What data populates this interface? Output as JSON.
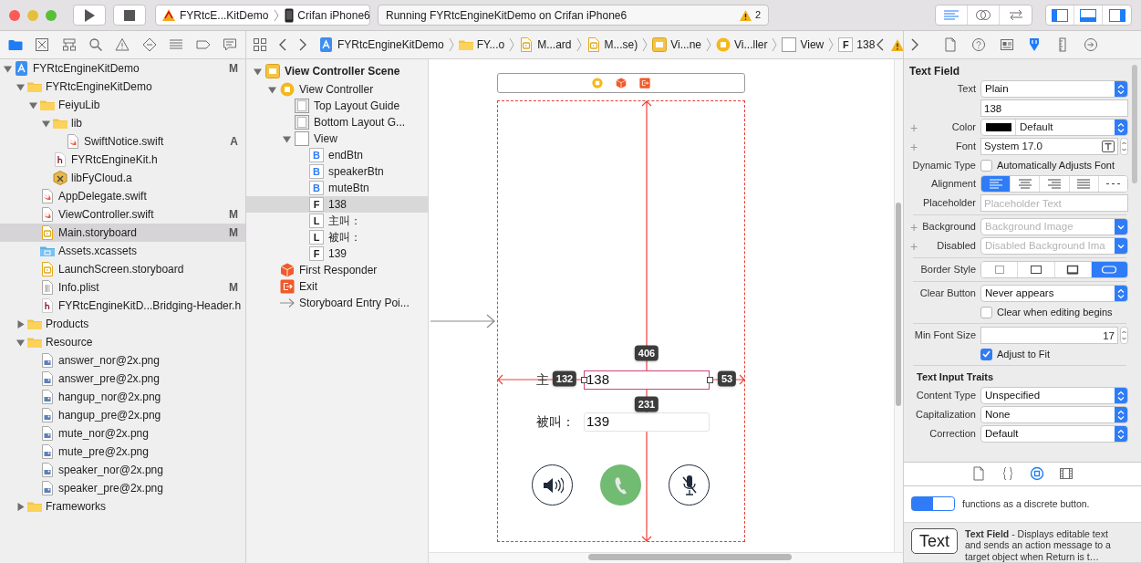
{
  "toolbar": {
    "scheme": {
      "target": "FYRtcE...KitDemo",
      "device": "Crifan iPhone6"
    },
    "activity": {
      "text": "Running FYRtcEngineKitDemo on Crifan iPhone6",
      "warnings": "2"
    },
    "editor_modes": [
      {
        "kind": "standard",
        "selected": true
      },
      {
        "kind": "assistant",
        "selected": false
      },
      {
        "kind": "version",
        "selected": false
      }
    ],
    "panels": [
      {
        "kind": "navigator",
        "on": true
      },
      {
        "kind": "debug",
        "on": true
      },
      {
        "kind": "utilities",
        "on": true
      }
    ]
  },
  "navigator_tabs": [
    {
      "kind": "project",
      "selected": true
    },
    {
      "kind": "source-control",
      "selected": false
    },
    {
      "kind": "symbol",
      "selected": false
    },
    {
      "kind": "find",
      "selected": false
    },
    {
      "kind": "issue",
      "selected": false
    },
    {
      "kind": "test",
      "selected": false
    },
    {
      "kind": "debug",
      "selected": false
    },
    {
      "kind": "breakpoint",
      "selected": false
    },
    {
      "kind": "report",
      "selected": false
    }
  ],
  "jump_bar": [
    {
      "kind": "project",
      "label": "FYRtcEngineKitDemo"
    },
    {
      "kind": "folder",
      "label": "FY...o"
    },
    {
      "kind": "storyboard",
      "label": "M...ard"
    },
    {
      "kind": "storyboard",
      "label": "M...se)"
    },
    {
      "kind": "scene",
      "label": "Vi...ne"
    },
    {
      "kind": "view-controller",
      "label": "Vi...ller"
    },
    {
      "kind": "view",
      "label": "View"
    },
    {
      "kind": "text-field",
      "glyph": "F",
      "label": "138"
    }
  ],
  "inspector_tabs": [
    {
      "kind": "file",
      "selected": false
    },
    {
      "kind": "help",
      "selected": false
    },
    {
      "kind": "identity",
      "selected": false
    },
    {
      "kind": "attributes",
      "selected": true
    },
    {
      "kind": "size",
      "selected": false
    },
    {
      "kind": "connections",
      "selected": false
    }
  ],
  "navigator": [
    {
      "label": "FYRtcEngineKitDemo",
      "kind": "project",
      "badge": "M",
      "selected": false,
      "expanded": true,
      "children": [
        {
          "label": "FYRtcEngineKitDemo",
          "kind": "folder",
          "selected": false,
          "expanded": true,
          "children": [
            {
              "label": "FeiyuLib",
              "kind": "folder",
              "selected": false,
              "expanded": true,
              "children": [
                {
                  "label": "lib",
                  "kind": "folder",
                  "selected": false,
                  "expanded": true,
                  "children": [
                    {
                      "label": "SwiftNotice.swift",
                      "kind": "swift",
                      "badge": "A",
                      "selected": false
                    }
                  ]
                },
                {
                  "label": "FYRtcEngineKit.h",
                  "kind": "header",
                  "selected": false
                },
                {
                  "label": "libFyCloud.a",
                  "kind": "library",
                  "selected": false
                }
              ]
            },
            {
              "label": "AppDelegate.swift",
              "kind": "swift",
              "selected": false
            },
            {
              "label": "ViewController.swift",
              "kind": "swift",
              "badge": "M",
              "selected": false
            },
            {
              "label": "Main.storyboard",
              "kind": "storyboard",
              "badge": "M",
              "selected": true
            },
            {
              "label": "Assets.xcassets",
              "kind": "assets",
              "selected": false
            },
            {
              "label": "LaunchScreen.storyboard",
              "kind": "storyboard",
              "selected": false
            },
            {
              "label": "Info.plist",
              "kind": "plist",
              "badge": "M",
              "selected": false
            },
            {
              "label": "FYRtcEngineKitD...Bridging-Header.h",
              "kind": "header",
              "selected": false
            }
          ]
        },
        {
          "label": "Products",
          "kind": "folder",
          "selected": false,
          "expanded": false
        },
        {
          "label": "Resource",
          "kind": "folder",
          "selected": false,
          "expanded": true,
          "children": [
            {
              "label": "answer_nor@2x.png",
              "kind": "image",
              "selected": false
            },
            {
              "label": "answer_pre@2x.png",
              "kind": "image",
              "selected": false
            },
            {
              "label": "hangup_nor@2x.png",
              "kind": "image",
              "selected": false
            },
            {
              "label": "hangup_pre@2x.png",
              "kind": "image",
              "selected": false
            },
            {
              "label": "mute_nor@2x.png",
              "kind": "image",
              "selected": false
            },
            {
              "label": "mute_pre@2x.png",
              "kind": "image",
              "selected": false
            },
            {
              "label": "speaker_nor@2x.png",
              "kind": "image",
              "selected": false
            },
            {
              "label": "speaker_pre@2x.png",
              "kind": "image",
              "selected": false
            }
          ]
        },
        {
          "label": "Frameworks",
          "kind": "folder",
          "selected": false,
          "expanded": false
        }
      ]
    }
  ],
  "outline": [
    {
      "label": "View Controller Scene",
      "kind": "scene",
      "selected": false,
      "expanded": true,
      "children": [
        {
          "label": "View Controller",
          "kind": "view-controller",
          "selected": false,
          "expanded": true,
          "children": [
            {
              "label": "Top Layout Guide",
              "kind": "layout-guide",
              "selected": false
            },
            {
              "label": "Bottom Layout G...",
              "kind": "layout-guide",
              "selected": false
            },
            {
              "label": "View",
              "kind": "view",
              "selected": false,
              "expanded": true,
              "children": [
                {
                  "label": "endBtn",
                  "kind": "button",
                  "glyph": "B",
                  "selected": false
                },
                {
                  "label": "speakerBtn",
                  "kind": "button",
                  "glyph": "B",
                  "selected": false
                },
                {
                  "label": "muteBtn",
                  "kind": "button",
                  "glyph": "B",
                  "selected": false
                },
                {
                  "label": "138",
                  "kind": "text-field",
                  "glyph": "F",
                  "selected": true
                },
                {
                  "label": "主叫：",
                  "kind": "label",
                  "glyph": "L",
                  "selected": false
                },
                {
                  "label": "被叫：",
                  "kind": "label",
                  "glyph": "L",
                  "selected": false
                },
                {
                  "label": "139",
                  "kind": "text-field",
                  "glyph": "F",
                  "selected": false
                }
              ]
            }
          ]
        },
        {
          "label": "First Responder",
          "kind": "first-responder",
          "selected": false
        },
        {
          "label": "Exit",
          "kind": "exit",
          "selected": false
        },
        {
          "label": "Storyboard Entry Poi...",
          "kind": "entry-point",
          "selected": false
        }
      ]
    }
  ],
  "canvas": {
    "scene_dock": [
      {
        "kind": "view-controller"
      },
      {
        "kind": "first-responder"
      },
      {
        "kind": "exit"
      }
    ],
    "constraints": [
      {
        "kind": "top",
        "value": "406"
      },
      {
        "kind": "leading",
        "value": "132"
      },
      {
        "kind": "trailing",
        "value": "53"
      },
      {
        "kind": "bottom",
        "value": "231"
      }
    ],
    "caller_label": "主",
    "caller_field": {
      "value": "138",
      "selected": true
    },
    "callee_label": "被叫：",
    "callee_field": {
      "value": "139",
      "selected": false
    },
    "call_buttons": [
      {
        "kind": "speaker"
      },
      {
        "kind": "answer"
      },
      {
        "kind": "mute"
      }
    ]
  },
  "inspector": {
    "title": "Text Field",
    "rows": [
      {
        "kind": "popup",
        "label": "Text",
        "value": "Plain"
      },
      {
        "kind": "text",
        "value": "138"
      },
      {
        "kind": "color",
        "label": "Color",
        "variation_button": "+",
        "color": "#000000",
        "value": "Default"
      },
      {
        "kind": "font",
        "label": "Font",
        "variation_button": "+",
        "value": "System 17.0"
      },
      {
        "kind": "checkbox",
        "label": "Dynamic Type",
        "text": "Automatically Adjusts Font",
        "checked": false
      },
      {
        "kind": "segments",
        "label": "Alignment",
        "segments": [
          {
            "kind": "left",
            "selected": true
          },
          {
            "kind": "center",
            "selected": false
          },
          {
            "kind": "right",
            "selected": false
          },
          {
            "kind": "justified",
            "selected": false
          },
          {
            "kind": "natural",
            "selected": false
          }
        ]
      },
      {
        "kind": "text",
        "label": "Placeholder",
        "placeholder": "Placeholder Text"
      },
      {
        "kind": "divider"
      },
      {
        "kind": "popup",
        "label": "Background",
        "variation_button": "+",
        "placeholder": "Background Image"
      },
      {
        "kind": "popup",
        "label": "Disabled",
        "variation_button": "+",
        "placeholder": "Disabled Background Ima"
      },
      {
        "kind": "divider"
      },
      {
        "kind": "segments",
        "label": "Border Style",
        "segments": [
          {
            "kind": "none",
            "selected": false
          },
          {
            "kind": "line",
            "selected": false
          },
          {
            "kind": "bezel",
            "selected": false
          },
          {
            "kind": "rounded",
            "selected": true
          }
        ]
      },
      {
        "kind": "divider"
      },
      {
        "kind": "popup",
        "label": "Clear Button",
        "value": "Never appears"
      },
      {
        "kind": "checkbox",
        "text": "Clear when editing begins",
        "checked": false
      },
      {
        "kind": "divider"
      },
      {
        "kind": "stepper",
        "label": "Min Font Size",
        "value": "17"
      },
      {
        "kind": "checkbox",
        "text": "Adjust to Fit",
        "checked": true
      },
      {
        "kind": "divider"
      },
      {
        "kind": "heading",
        "text": "Text Input Traits"
      },
      {
        "kind": "popup",
        "label": "Content Type",
        "value": "Unspecified"
      },
      {
        "kind": "popup",
        "label": "Capitalization",
        "value": "None"
      },
      {
        "kind": "popup",
        "label": "Correction",
        "value": "Default"
      }
    ]
  },
  "library": {
    "tabs": [
      {
        "kind": "file",
        "selected": false
      },
      {
        "kind": "braces",
        "selected": false
      },
      {
        "kind": "object",
        "selected": true
      },
      {
        "kind": "media",
        "selected": false
      }
    ],
    "items": [
      {
        "kind": "segmented-control",
        "description": "functions as a discrete button."
      },
      {
        "kind": "text-field",
        "icon_text": "Text",
        "description": "**Text Field** - Displays editable text and sends an action message to a target object when Return is t…"
      }
    ]
  }
}
